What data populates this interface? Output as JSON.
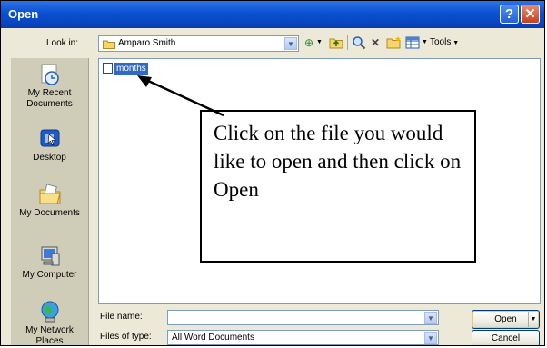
{
  "dialog": {
    "title": "Open",
    "help_glyph": "?",
    "close_glyph": "✕"
  },
  "lookin": {
    "label": "Look in:",
    "value": "Amparo Smith"
  },
  "toolbar": {
    "tools_label": "Tools"
  },
  "places": [
    {
      "label": "My Recent Documents"
    },
    {
      "label": "Desktop"
    },
    {
      "label": "My Documents"
    },
    {
      "label": "My Computer"
    },
    {
      "label": "My Network Places"
    }
  ],
  "files": [
    {
      "name": "months"
    }
  ],
  "callout": {
    "text": "Click on the file you would like to open and then click on Open"
  },
  "filename": {
    "label": "File name:",
    "value": ""
  },
  "filetype": {
    "label": "Files of type:",
    "value": "All Word Documents"
  },
  "buttons": {
    "open": "Open",
    "cancel": "Cancel"
  }
}
